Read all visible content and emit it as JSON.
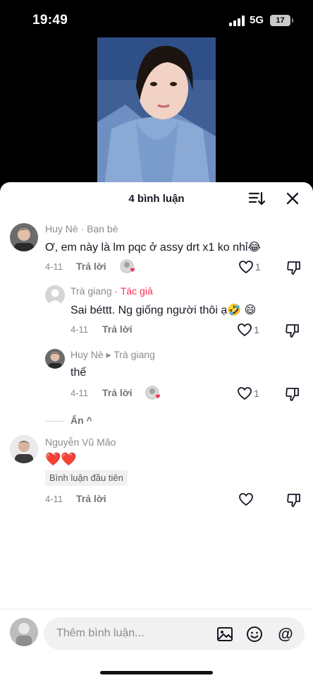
{
  "status_bar": {
    "time": "19:49",
    "network": "5G",
    "battery": "17"
  },
  "sheet": {
    "title": "4 bình luận"
  },
  "comments": [
    {
      "author": "Huy Nè",
      "tag": "· Bạn bè",
      "text": "Ơ, em này là lm pqc ở assy drt x1 ko nhỉ😂",
      "date": "4-11",
      "reply_label": "Trả lời",
      "likes": "1"
    },
    {
      "author": "Trà giang",
      "tag": "· Tác giả",
      "text": "Sai béttt. Ng giống người thôi ạ🤣 😄",
      "date": "4-11",
      "reply_label": "Trả lời",
      "likes": "1"
    },
    {
      "author": "Huy Nè",
      "tag": "▸ Trà giang",
      "text": "thế",
      "date": "4-11",
      "reply_label": "Trả lời",
      "likes": "1"
    },
    {
      "author": "Nguyễn Vũ Mão",
      "text": "❤️❤️",
      "badge": "Bình luận đầu tiên",
      "date": "4-11",
      "reply_label": "Trả lời"
    }
  ],
  "collapse_label": "Ẩn ^",
  "input": {
    "placeholder": "Thêm bình luận..."
  },
  "colors": {
    "author_tag": "#fe2c55",
    "accent_heart": "#fe2c55"
  },
  "icons": [
    "sort-icon",
    "close-icon",
    "heart-icon",
    "dislike-icon",
    "image-icon",
    "emoji-icon",
    "mention-icon"
  ]
}
